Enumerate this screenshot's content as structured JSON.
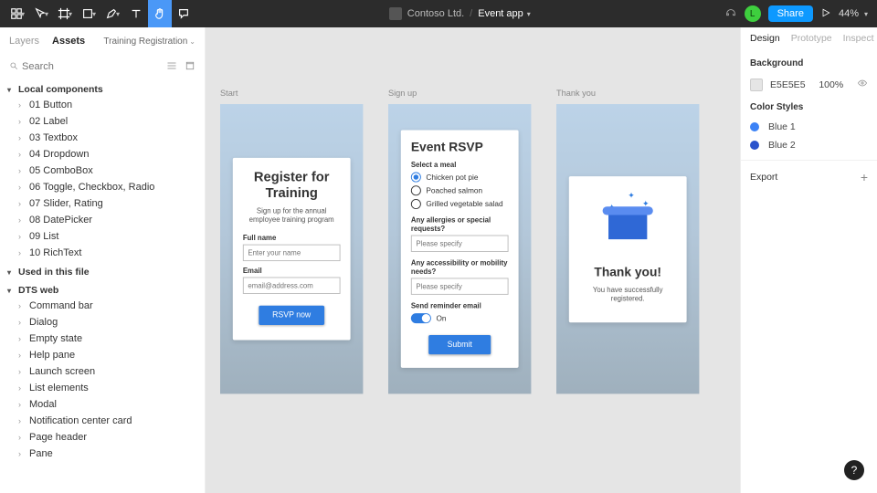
{
  "topbar": {
    "org": "Contoso Ltd.",
    "file": "Event app",
    "avatar": "L",
    "share": "Share",
    "zoom": "44%"
  },
  "left": {
    "tabs": {
      "layers": "Layers",
      "assets": "Assets"
    },
    "page": "Training Registration",
    "searchPlaceholder": "Search",
    "sections": [
      {
        "title": "Local components",
        "items": [
          "01 Button",
          "02 Label",
          "03 Textbox",
          "04 Dropdown",
          "05 ComboBox",
          "06 Toggle, Checkbox, Radio",
          "07 Slider, Rating",
          "08 DatePicker",
          "09 List",
          "10 RichText"
        ]
      },
      {
        "title": "Used in this file",
        "items": []
      },
      {
        "title": "DTS web",
        "items": [
          "Command bar",
          "Dialog",
          "Empty state",
          "Help pane",
          "Launch screen",
          "List elements",
          "Modal",
          "Notification center card",
          "Page header",
          "Pane"
        ]
      }
    ]
  },
  "canvas": {
    "frames": [
      {
        "label": "Start",
        "title": "Register for Training",
        "subtitle": "Sign up for the annual employee training program",
        "field1Label": "Full name",
        "field1Placeholder": "Enter your name",
        "field2Label": "Email",
        "field2Placeholder": "email@address.com",
        "cta": "RSVP now"
      },
      {
        "label": "Sign up",
        "title": "Event RSVP",
        "mealLabel": "Select a meal",
        "meals": [
          "Chicken pot pie",
          "Poached salmon",
          "Grilled vegetable salad"
        ],
        "q1": "Any allergies or special requests?",
        "q2": "Any accessibility or mobility needs?",
        "ph": "Please specify",
        "reminderLabel": "Send reminder email",
        "reminderState": "On",
        "cta": "Submit"
      },
      {
        "label": "Thank you",
        "title": "Thank you!",
        "sub": "You have successfully registered."
      }
    ]
  },
  "right": {
    "tabs": {
      "design": "Design",
      "prototype": "Prototype",
      "inspect": "Inspect"
    },
    "bgTitle": "Background",
    "bgHex": "E5E5E5",
    "bgOpacity": "100%",
    "colorTitle": "Color Styles",
    "c1": "Blue 1",
    "c2": "Blue 2",
    "export": "Export"
  },
  "helpLabel": "?"
}
